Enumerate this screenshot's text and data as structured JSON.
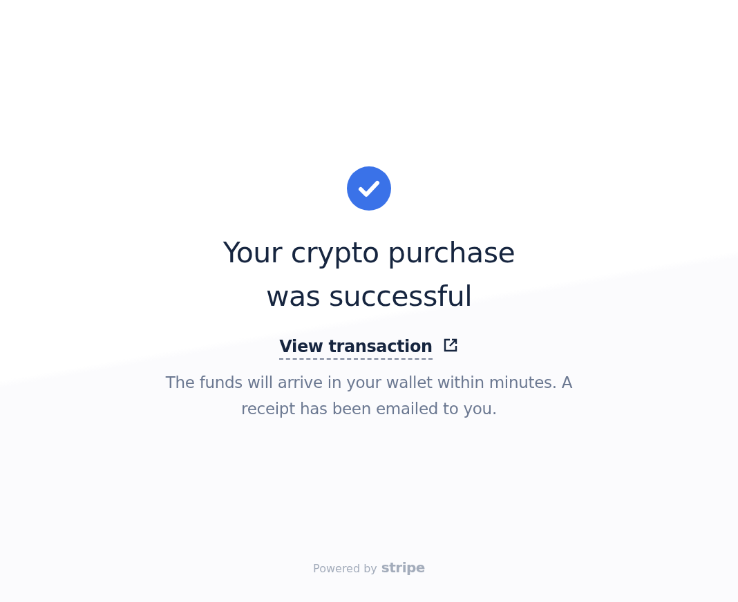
{
  "status": {
    "title": "Your crypto purchase was successful",
    "link": "View transaction",
    "message": "The funds will arrive in your wallet within minutes. A receipt has been emailed to you."
  },
  "footer": {
    "prefix": "Powered by",
    "brand": "stripe"
  }
}
